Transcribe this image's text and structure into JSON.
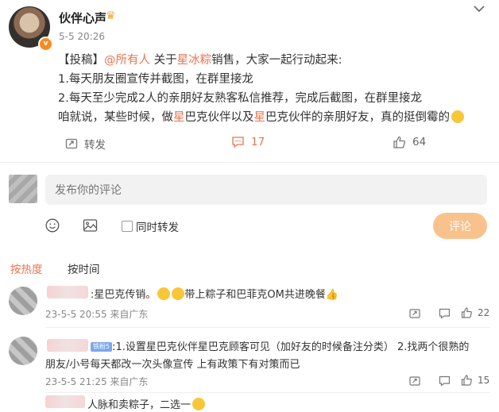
{
  "post": {
    "username": "伙伴心声",
    "time": "5-5 20:26",
    "line1_prefix": "【投稿】",
    "mention": "@所有人",
    "line1_mid": " 关于",
    "line1_hl": "星冰粽",
    "line1_suffix": "销售，大家一起行动起来:",
    "line2": "1.每天朋友圈宣传并截图，在群里接龙",
    "line3": "2.每天至少完成2人的亲朋好友熟客私信推荐，完成后截图，在群里接龙",
    "line4_a": "咱就说，某些时候，做",
    "line4_hl1": "星",
    "line4_b": "巴克伙伴以及",
    "line4_hl2": "星",
    "line4_c": "巴克伙伴的亲朋好友，真的挺倒霉的",
    "repost_label": "转发",
    "comment_count": "17",
    "like_count": "64"
  },
  "composer": {
    "placeholder": "发布你的评论",
    "repost_checkbox_label": "同时转发",
    "submit_label": "评论"
  },
  "sort_tabs": [
    "按热度",
    "按时间"
  ],
  "comments": [
    {
      "text_a": ":星巴克传销。",
      "text_b": "带上粽子和巴菲克OM共进晚餐",
      "time": "23-5-5 20:55 来自广东",
      "likes": "22"
    },
    {
      "fan_badge": "铁粉5",
      "line1": ":1.设置星巴克伙伴星巴克顾客可见（加好友的时候备注分类） 2.找两个很熟的",
      "line2": "朋友/小号每天都改一次头像宣传 上有政策下有对策而已",
      "time": "23-5-5 21:25 来自广东",
      "likes": "15"
    },
    {
      "text": "人脉和卖粽子，二选一"
    }
  ]
}
